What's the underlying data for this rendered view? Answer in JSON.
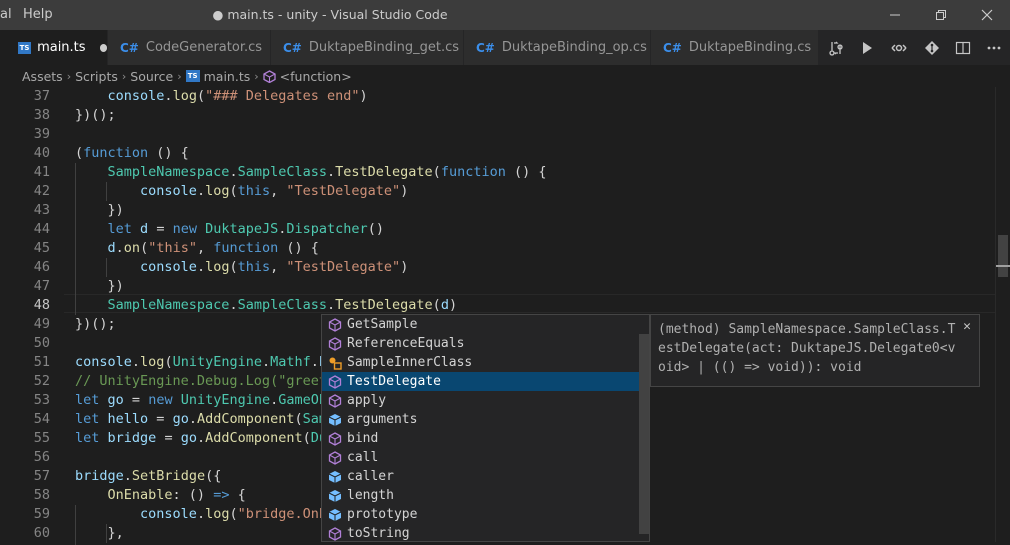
{
  "titlebar": {
    "menu": [
      "al",
      "Help"
    ],
    "title": "● main.ts - unity - Visual Studio Code"
  },
  "tabs": [
    {
      "label": "main.ts",
      "lang": "TS",
      "active": true,
      "dirty": true
    },
    {
      "label": "CodeGenerator.cs",
      "lang": "C#",
      "active": false
    },
    {
      "label": "DuktapeBinding_get.cs",
      "lang": "C#",
      "active": false
    },
    {
      "label": "DuktapeBinding_op.cs",
      "lang": "C#",
      "active": false
    },
    {
      "label": "DuktapeBinding.cs",
      "lang": "C#",
      "active": false
    }
  ],
  "breadcrumbs": [
    "Assets",
    "Scripts",
    "Source",
    "main.ts",
    "<function>"
  ],
  "editor": {
    "line_numbers": [
      "37",
      "38",
      "39",
      "40",
      "41",
      "42",
      "43",
      "44",
      "45",
      "46",
      "47",
      "48",
      "49",
      "50",
      "51",
      "52",
      "53",
      "54",
      "55",
      "56",
      "57",
      "58",
      "59",
      "60"
    ],
    "current_line": "48"
  },
  "suggest": {
    "items": [
      {
        "label": "GetSample",
        "kind": "method"
      },
      {
        "label": "ReferenceEquals",
        "kind": "method"
      },
      {
        "label": "SampleInnerClass",
        "kind": "class"
      },
      {
        "label": "TestDelegate",
        "kind": "method",
        "selected": true
      },
      {
        "label": "apply",
        "kind": "method"
      },
      {
        "label": "arguments",
        "kind": "field"
      },
      {
        "label": "bind",
        "kind": "method"
      },
      {
        "label": "call",
        "kind": "method"
      },
      {
        "label": "caller",
        "kind": "field"
      },
      {
        "label": "length",
        "kind": "field"
      },
      {
        "label": "prototype",
        "kind": "field"
      },
      {
        "label": "toString",
        "kind": "method"
      }
    ]
  },
  "detail": {
    "lines": [
      "(method) SampleNamespace.SampleClass.T",
      "estDelegate(act: DuktapeJS.Delegate0<v",
      "oid> | (() => void)): void"
    ]
  },
  "colors": {
    "accent": "#094771",
    "ts_badge": "#3178c6",
    "cs_badge": "#3b8eea"
  }
}
